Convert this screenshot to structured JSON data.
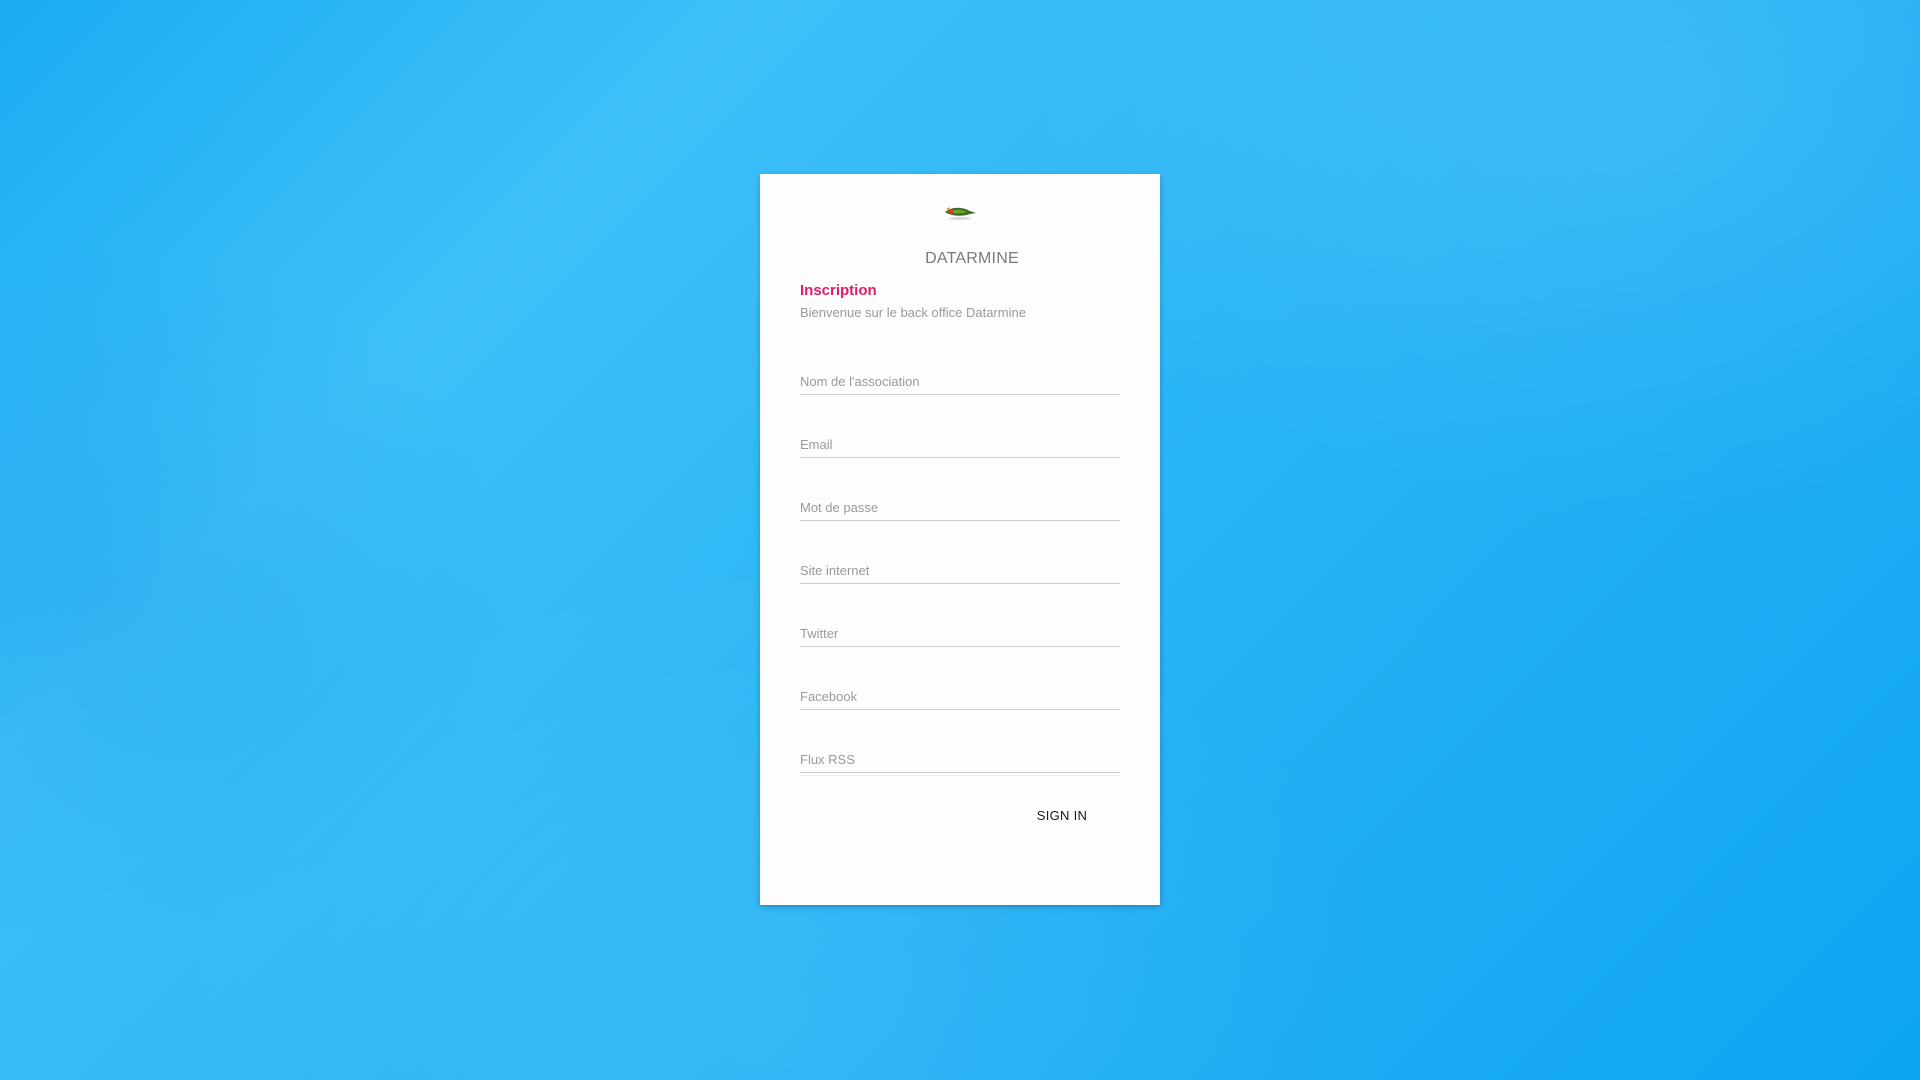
{
  "brand": {
    "logo_icon": "bird-logo-icon",
    "name": "DATARMINE"
  },
  "form": {
    "title": "Inscription",
    "subtitle": "Bienvenue sur le back office Datarmine",
    "fields": [
      {
        "placeholder": "Nom de l'association",
        "value": ""
      },
      {
        "placeholder": "Email",
        "value": ""
      },
      {
        "placeholder": "Mot de passe",
        "value": ""
      },
      {
        "placeholder": "Site internet",
        "value": ""
      },
      {
        "placeholder": "Twitter",
        "value": ""
      },
      {
        "placeholder": "Facebook",
        "value": ""
      },
      {
        "placeholder": "Flux RSS",
        "value": ""
      }
    ],
    "submit_label": "SIGN IN"
  },
  "colors": {
    "accent": "#e21d66",
    "background": "#29b6f6",
    "card": "#fdfdfd"
  }
}
